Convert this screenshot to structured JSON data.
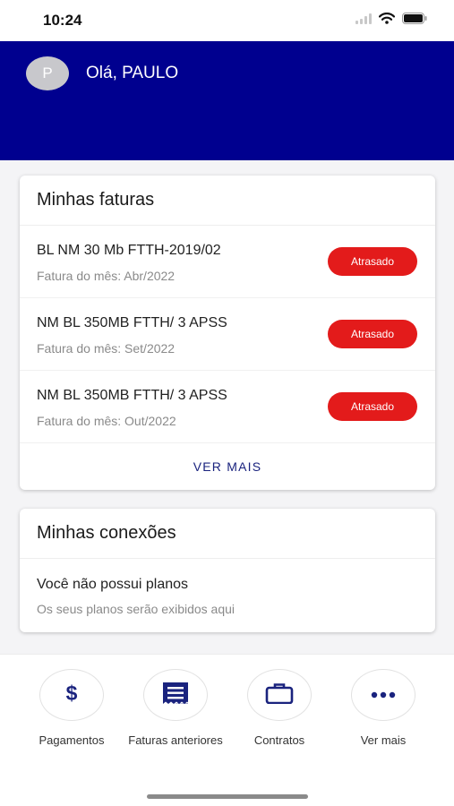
{
  "status_bar": {
    "time": "10:24"
  },
  "header": {
    "avatar_initial": "P",
    "greeting": "Olá, PAULO"
  },
  "invoices_card": {
    "title": "Minhas faturas",
    "items": [
      {
        "name": "BL NM 30 Mb FTTH-2019/02",
        "month": "Fatura do mês: Abr/2022",
        "status": "Atrasado"
      },
      {
        "name": "NM BL 350MB FTTH/ 3 APSS",
        "month": "Fatura do mês: Set/2022",
        "status": "Atrasado"
      },
      {
        "name": "NM BL 350MB FTTH/ 3 APSS",
        "month": "Fatura do mês: Out/2022",
        "status": "Atrasado"
      }
    ],
    "see_more": "VER MAIS"
  },
  "connections_card": {
    "title": "Minhas conexões",
    "empty_title": "Você não possui planos",
    "empty_subtitle": "Os seus planos serão exibidos aqui"
  },
  "actions": [
    {
      "icon": "dollar-icon",
      "label": "Pagamentos"
    },
    {
      "icon": "receipt-icon",
      "label": "Faturas anteriores"
    },
    {
      "icon": "briefcase-icon",
      "label": "Contratos"
    },
    {
      "icon": "more-horizontal-icon",
      "label": "Ver mais"
    }
  ],
  "colors": {
    "brand": "#00008f",
    "overdue": "#e31b1b",
    "icon": "#1a237e"
  }
}
